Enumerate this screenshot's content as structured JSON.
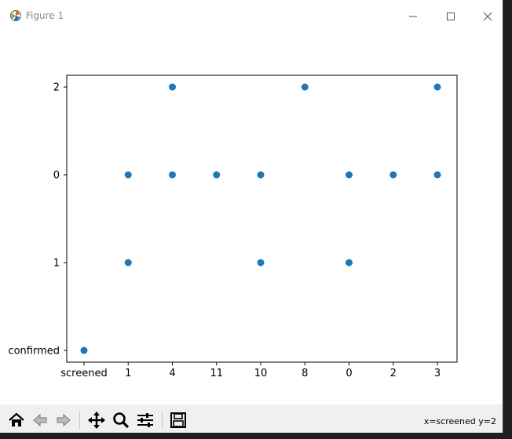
{
  "window": {
    "title": "Figure 1"
  },
  "toolbar": {
    "tools": [
      "home-icon",
      "back-icon",
      "forward-icon",
      "pan-icon",
      "zoom-icon",
      "configure-subplots-icon",
      "save-icon"
    ],
    "coords_text": "x=screened y=2"
  },
  "colors": {
    "marker": "#1f77b4",
    "window_bg": "#ffffff",
    "toolbar_bg": "#f0f0f0"
  },
  "chart_data": {
    "type": "scatter",
    "categories": [
      "screened",
      "1",
      "4",
      "11",
      "10",
      "8",
      "0",
      "2",
      "3"
    ],
    "y_categories": [
      "confirmed",
      "1",
      "0",
      "2"
    ],
    "points": [
      {
        "x": "screened",
        "y": "confirmed"
      },
      {
        "x": "1",
        "y": "0"
      },
      {
        "x": "1",
        "y": "1"
      },
      {
        "x": "4",
        "y": "2"
      },
      {
        "x": "4",
        "y": "0"
      },
      {
        "x": "11",
        "y": "0"
      },
      {
        "x": "10",
        "y": "0"
      },
      {
        "x": "10",
        "y": "1"
      },
      {
        "x": "8",
        "y": "2"
      },
      {
        "x": "0",
        "y": "0"
      },
      {
        "x": "0",
        "y": "1"
      },
      {
        "x": "2",
        "y": "0"
      },
      {
        "x": "3",
        "y": "2"
      },
      {
        "x": "3",
        "y": "0"
      }
    ],
    "title": "",
    "xlabel": "",
    "ylabel": "",
    "grid": false,
    "legend": false
  }
}
